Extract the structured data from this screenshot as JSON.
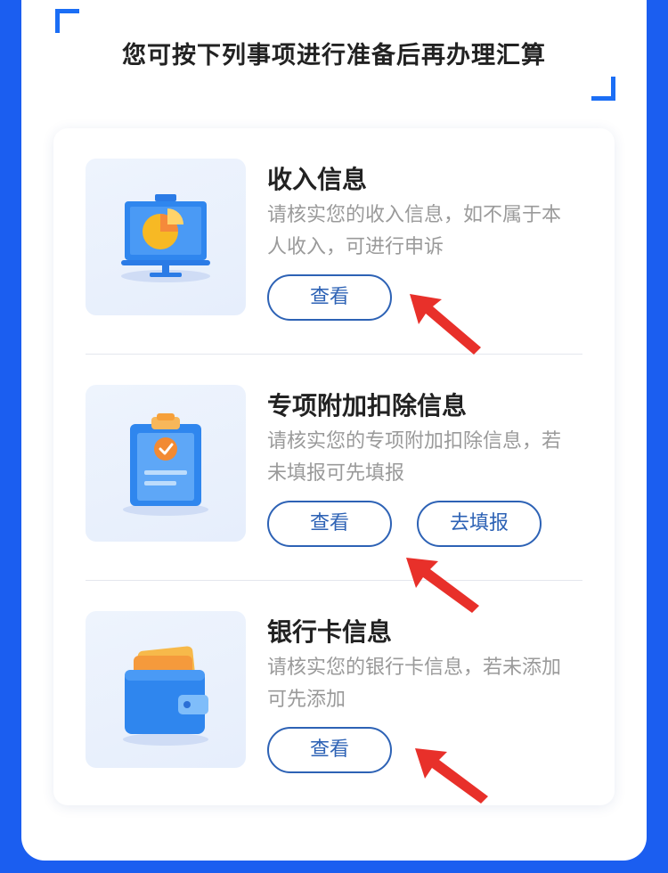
{
  "header": {
    "title": "您可按下列事项进行准备后再办理汇算"
  },
  "items": [
    {
      "title": "收入信息",
      "description": "请核实您的收入信息，如不属于本人收入，可进行申诉",
      "view_label": "查看",
      "icon": "presentation-chart-icon"
    },
    {
      "title": "专项附加扣除信息",
      "description": "请核实您的专项附加扣除信息，若未填报可先填报",
      "view_label": "查看",
      "fill_label": "去填报",
      "icon": "clipboard-check-icon"
    },
    {
      "title": "银行卡信息",
      "description": "请核实您的银行卡信息，若未添加可先添加",
      "view_label": "查看",
      "icon": "wallet-card-icon"
    }
  ],
  "colors": {
    "background": "#1b5ef0",
    "accent": "#2d62b5",
    "annotation_arrow": "#e8302a"
  }
}
